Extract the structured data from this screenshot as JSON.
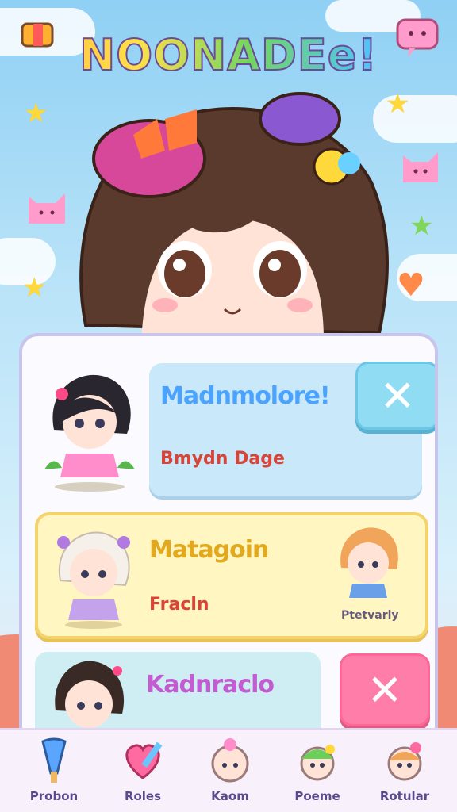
{
  "app": {
    "title": "NOONADEe!"
  },
  "cards": [
    {
      "name": "Madnmolore!",
      "subtitle": "Bmydn Dage",
      "name_color": "#4aa3ff",
      "sub_color": "#d94438"
    },
    {
      "name": "Matagoin",
      "subtitle": "Fracln",
      "extra_label": "Ptetvarly",
      "name_color": "#e2a81e",
      "sub_color": "#d94438"
    },
    {
      "name": "Kadnraclo",
      "name_color": "#c35bd1"
    }
  ],
  "close_symbol": "✕",
  "tabs": [
    {
      "label": "Probon",
      "icon": "popsicle-icon"
    },
    {
      "label": "Roles",
      "icon": "heart-pencil-icon"
    },
    {
      "label": "Kaom",
      "icon": "chibi-face-icon"
    },
    {
      "label": "Poeme",
      "icon": "chibi-cap-icon"
    },
    {
      "label": "Rotular",
      "icon": "chibi-bun-icon"
    }
  ],
  "colors": {
    "accent_blue": "#8fdcf3",
    "accent_pink": "#ff7ea9",
    "panel_border": "#c8c4ec",
    "highlight_yellow": "#fff6c2"
  }
}
